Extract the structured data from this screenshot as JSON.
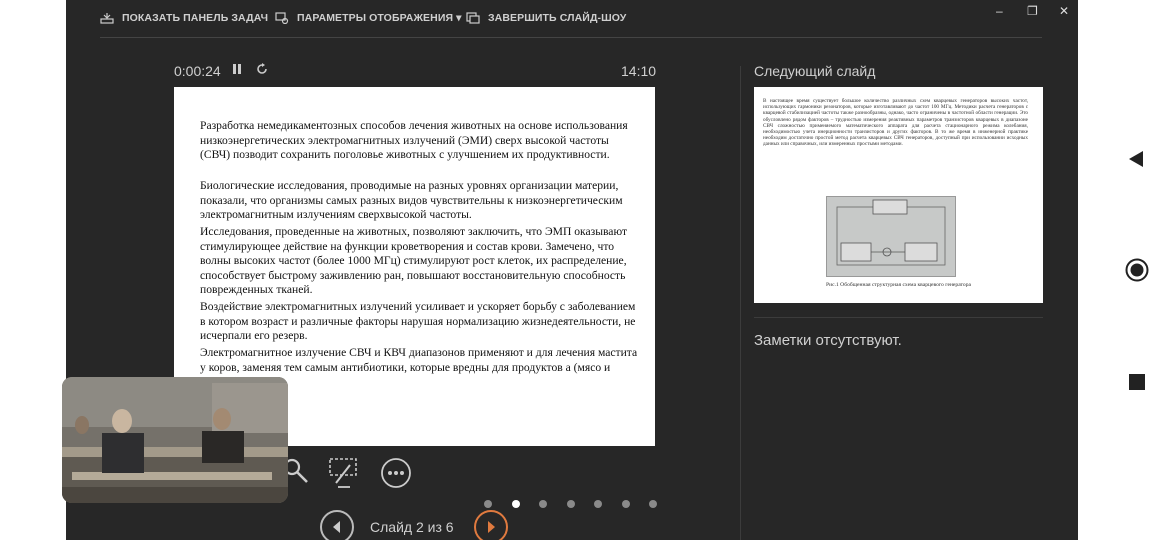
{
  "toolbar": {
    "show_taskbar": "ПОКАЗАТЬ ПАНЕЛЬ ЗАДАЧ",
    "display_settings": "ПАРАМЕТРЫ ОТОБРАЖЕНИЯ ▾",
    "end_show": "ЗАВЕРШИТЬ СЛАЙД-ШОУ"
  },
  "window": {
    "minimize": "‒",
    "restore": "❐",
    "close": "✕"
  },
  "timer": {
    "elapsed": "0:00:24",
    "clock": "14:10"
  },
  "slide": {
    "paragraphs": [
      "Разработка немедикаментозных способов лечения животных на основе использования низкоэнергетических электромагнитных излучений (ЭМИ) сверх высокой частоты (СВЧ) позводит сохранить поголовье животных с улучшением их продуктивности.",
      " Биологические исследования, проводимые на разных уровнях организации материи, показали, что организмы самых разных видов чувствительны к низкоэнергетическим электромагнитным излучениям сверхвысокой частоты.",
      " Исследования, проведенные на животных, позволяют заключить, что ЭМП оказывают стимулирующее действие на функции кроветворения и состав крови. Замечено, что волны высоких частот (более 1000 МГц) стимулируют рост клеток, их распределение, способствует быстрому заживлению ран, повышают восстановительную способность поврежденных тканей.",
      " Воздействие электромагнитных излучений усиливает и ускоряет борьбу с заболеванием в котором возраст и различные факторы нарушая нормализацию жизнедеятельности, не исчерпали его резерв.",
      " Электромагнитное излучение СВЧ и КВЧ диапазонов применяют и для лечения мастита у коров, заменяя тем самым антибиотики, которые вредны для продуктов                    а (мясо и молоко)."
    ]
  },
  "next": {
    "label": "Следующий слайд",
    "text": "В настоящее время существует большое количество различных схем кварцевых генераторов высоких частот, использующих гармоники резонаторов, которые изготавливают до частот 100 МГц. Методики расчета генераторов с кварцевой стабилизацией частоты также разнообразны, однако, часто ограничены в частотной области генерации. Это обусловлено рядом факторов – трудностью измерения реактивных параметров транзисторов кварцевых в диапазоне СВЧ сложностью применяемого математического аппарата для расчета стационарного режима колебания, необходимостью учета инерционности транзисторов и других факторов. В то же время в инженерной практике необходим достаточно простой метод расчета кварцевых СВЧ генераторов, доступный при использовании исходных данных или справочных, или измеренных простыми методами.",
    "caption": "Рис.1 Обобщенная структурная схема кварцевого генератора"
  },
  "notes": "Заметки отсутствуют.",
  "nav": {
    "counter": "Слайд 2 из 6",
    "total_dots": 7,
    "active_dot": 1
  },
  "icons": [
    "taskbar-icon",
    "display-settings-icon",
    "end-show-icon",
    "pause-icon",
    "restart-icon",
    "search-icon",
    "pen-icon",
    "more-icon",
    "prev-icon",
    "next-icon",
    "side-back-icon",
    "side-home-icon",
    "side-stop-icon"
  ]
}
